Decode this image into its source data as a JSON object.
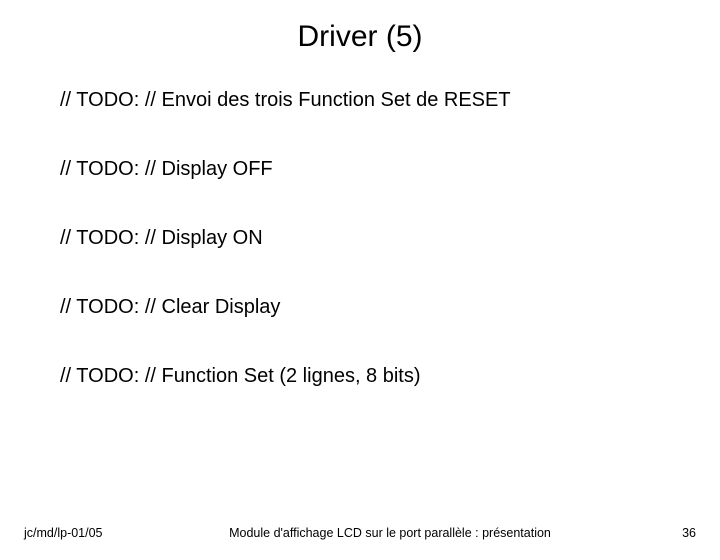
{
  "title": "Driver (5)",
  "lines": [
    "// TODO: // Envoi des trois Function Set de RESET",
    "// TODO: // Display OFF",
    "// TODO: // Display ON",
    "// TODO: // Clear Display",
    "// TODO: // Function Set (2 lignes, 8 bits)"
  ],
  "footer": {
    "left": "jc/md/lp-01/05",
    "center": "Module d'affichage LCD sur le port parallèle : présentation",
    "right": "36"
  }
}
